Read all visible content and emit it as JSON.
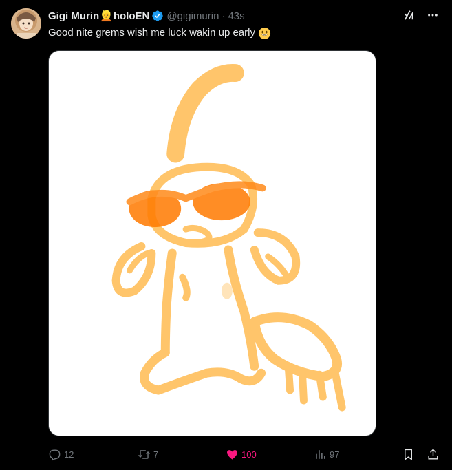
{
  "author": {
    "display_name": "Gigi Murin",
    "name_emoji": "👱",
    "name_suffix": "holoEN",
    "handle": "@gigimurin",
    "separator": "·",
    "time": "43s"
  },
  "tweet": {
    "text": "Good nite grems wish me luck wakin up early",
    "emoji": "smiling-face-emoji"
  },
  "actions": {
    "reply_count": "12",
    "retweet_count": "7",
    "like_count": "100",
    "views_count": "97"
  },
  "colors": {
    "background": "#000000",
    "primary_text": "#e7e9ea",
    "secondary_text": "#71767b",
    "verified_blue": "#1d9bf0",
    "like_pink": "#f91880",
    "drawing_orange": "#ffb23a",
    "drawing_dark_orange": "#ff7a00"
  },
  "icons": {
    "verified": "verified-badge-icon",
    "grok": "grok-icon",
    "more": "more-dots-icon",
    "reply": "reply-icon",
    "retweet": "retweet-icon",
    "like": "heart-icon",
    "views": "views-icon",
    "bookmark": "bookmark-icon",
    "share": "share-icon"
  }
}
